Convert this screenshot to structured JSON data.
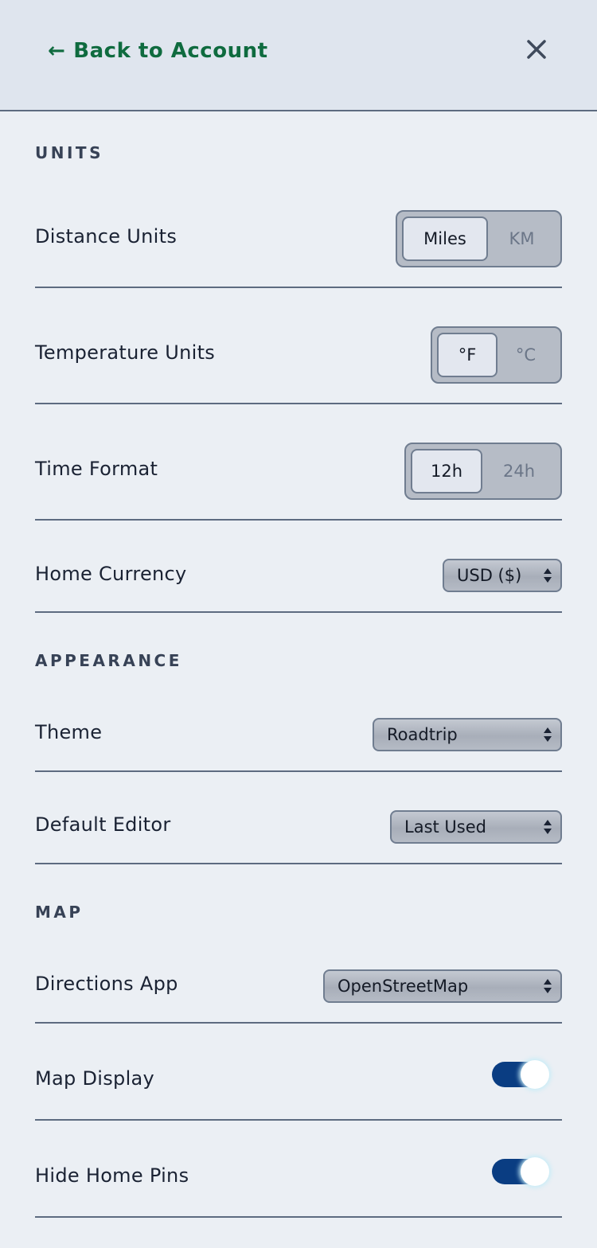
{
  "header": {
    "back_arrow": "←",
    "back_label": "Back to Account",
    "close_icon": "close-icon"
  },
  "sections": {
    "units": "UNITS",
    "appearance": "APPEARANCE",
    "map": "MAP"
  },
  "units": {
    "distance": {
      "label": "Distance Units",
      "options": [
        "Miles",
        "KM"
      ],
      "selected": "Miles"
    },
    "temperature": {
      "label": "Temperature Units",
      "options": [
        "°F",
        "°C"
      ],
      "selected": "°F"
    },
    "time": {
      "label": "Time Format",
      "options": [
        "12h",
        "24h"
      ],
      "selected": "12h"
    },
    "currency": {
      "label": "Home Currency",
      "value": "USD ($)"
    }
  },
  "appearance": {
    "theme": {
      "label": "Theme",
      "value": "Roadtrip"
    },
    "editor": {
      "label": "Default Editor",
      "value": "Last Used"
    }
  },
  "map": {
    "directions": {
      "label": "Directions App",
      "value": "OpenStreetMap"
    },
    "display": {
      "label": "Map Display",
      "on": true
    },
    "hide_pins": {
      "label": "Hide Home Pins",
      "on": true
    }
  },
  "colors": {
    "link": "#0f6b3f",
    "toggle_on": "#0a3d82",
    "background": "#ebeff4",
    "header": "#dfe5ee"
  }
}
